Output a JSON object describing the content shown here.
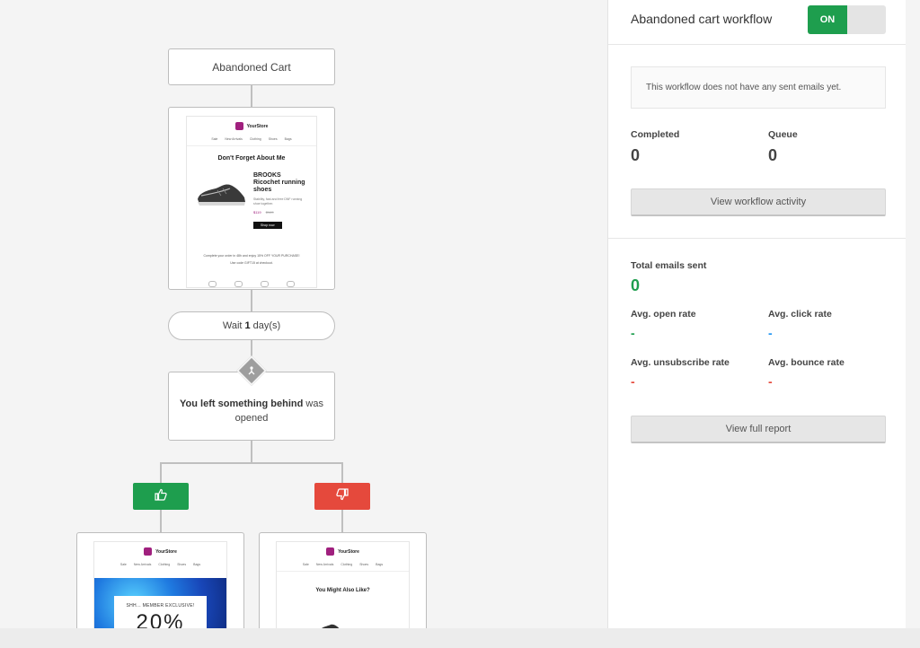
{
  "workflow": {
    "trigger_label": "Abandoned Cart",
    "email_1": {
      "brand": "YourStore",
      "nav": [
        "Sale",
        "New Arrivals",
        "Clothing",
        "Shoes",
        "Bags"
      ],
      "heading": "Don't Forget About Me",
      "product_name": "BROOKS Ricochet running shoes",
      "product_desc": "Stability, fast and free DNF running shoe together.",
      "price": "$119",
      "price_old": "$149",
      "shop_label": "Shop now",
      "footer_line1": "Complete your order in 48h and enjoy 15% OFF YOUR PURCHASE!",
      "footer_line2": "Use code GIFT15 at checkout."
    },
    "wait": {
      "prefix": "Wait",
      "amount": "1",
      "suffix": "day(s)"
    },
    "condition": {
      "bold": "You left something behind",
      "rest": " was opened"
    },
    "email_yes": {
      "brand": "YourStore",
      "nav": [
        "Sale",
        "New Arrivals",
        "Clothing",
        "Shoes",
        "Bags"
      ],
      "promo_text": "SHH... MEMBER EXCLUSIVE!",
      "promo_big": "20%"
    },
    "email_no": {
      "brand": "YourStore",
      "nav": [
        "Sale",
        "New Arrivals",
        "Clothing",
        "Shoes",
        "Bags"
      ],
      "heading": "You Might Also Like?"
    }
  },
  "panel": {
    "title": "Abandoned cart workflow",
    "toggle_label": "ON",
    "notice": "This workflow does not have any sent emails yet.",
    "completed_label": "Completed",
    "completed_value": "0",
    "queue_label": "Queue",
    "queue_value": "0",
    "activity_button": "View workflow activity",
    "total_label": "Total emails sent",
    "total_value": "0",
    "open_label": "Avg. open rate",
    "open_value": "-",
    "click_label": "Avg. click rate",
    "click_value": "-",
    "unsub_label": "Avg. unsubscribe rate",
    "unsub_value": "-",
    "bounce_label": "Avg. bounce rate",
    "bounce_value": "-",
    "report_button": "View full report"
  },
  "colors": {
    "green": "#1e9e4e",
    "red": "#e5493c",
    "blue": "#2196f3",
    "brand_purple": "#a0207e"
  },
  "icons": {
    "yes_branch": "thumbs-up-icon",
    "no_branch": "thumbs-down-icon",
    "condition": "split-icon"
  }
}
